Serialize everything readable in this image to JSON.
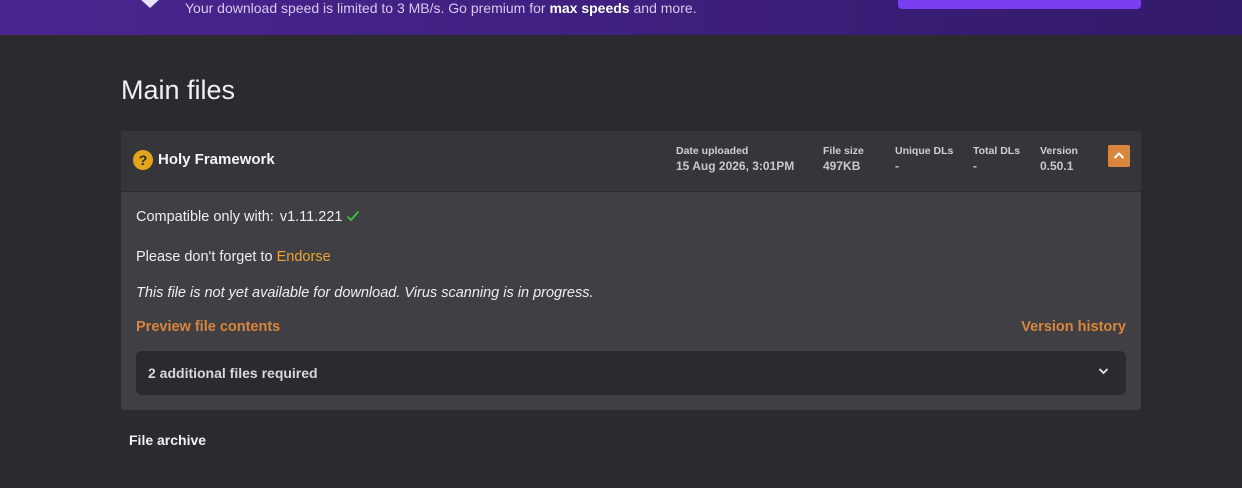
{
  "banner": {
    "text_before": "Your download speed is limited to 3 MB/s. Go premium for ",
    "text_bold": "max speeds",
    "text_after": " and more."
  },
  "page_title": "Main files",
  "file": {
    "name": "Holy Framework",
    "stats": [
      {
        "label": "Date uploaded",
        "value": "15 Aug 2026, 3:01PM"
      },
      {
        "label": "File size",
        "value": "497KB"
      },
      {
        "label": "Unique DLs",
        "value": "-"
      },
      {
        "label": "Total DLs",
        "value": "-"
      },
      {
        "label": "Version",
        "value": "0.50.1"
      }
    ],
    "compat_label": "Compatible only with:",
    "compat_version": "v1.11.221",
    "endorse_prefix": "Please don't forget to ",
    "endorse_link": "Endorse",
    "scan_note": "This file is not yet available for download. Virus scanning is in progress.",
    "preview_link": "Preview file contents",
    "version_history_link": "Version history",
    "required_text": "2 additional files required"
  },
  "archive_title": "File archive",
  "colors": {
    "accent_orange": "#d9853b",
    "banner_purple": "#3d1f7c",
    "premium_button": "#7b3ff2",
    "check_green": "#3ec13e"
  }
}
